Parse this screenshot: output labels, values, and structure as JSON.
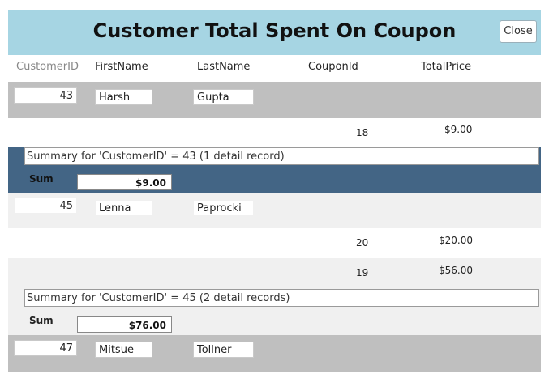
{
  "report": {
    "title": "Customer Total Spent On Coupon",
    "close_label": "Close"
  },
  "columns": {
    "customer_id": "CustomerID",
    "first_name": "FirstName",
    "last_name": "LastName",
    "coupon_id": "CouponId",
    "total_price": "TotalPrice"
  },
  "groups": [
    {
      "customer_id": "43",
      "first_name": "Harsh",
      "last_name": "Gupta",
      "details": [
        {
          "coupon_id": "18",
          "total_price": "$9.00"
        }
      ],
      "summary": "Summary for 'CustomerID' =  43 (1 detail record)",
      "sum_label": "Sum",
      "sum_value": "$9.00"
    },
    {
      "customer_id": "45",
      "first_name": "Lenna",
      "last_name": "Paprocki",
      "details": [
        {
          "coupon_id": "20",
          "total_price": "$20.00"
        },
        {
          "coupon_id": "19",
          "total_price": "$56.00"
        }
      ],
      "summary": "Summary for 'CustomerID' =  45 (2 detail records)",
      "sum_label": "Sum",
      "sum_value": "$76.00"
    },
    {
      "customer_id": "47",
      "first_name": "Mitsue",
      "last_name": "Tollner",
      "details": [],
      "summary": "",
      "sum_label": "",
      "sum_value": ""
    }
  ]
}
